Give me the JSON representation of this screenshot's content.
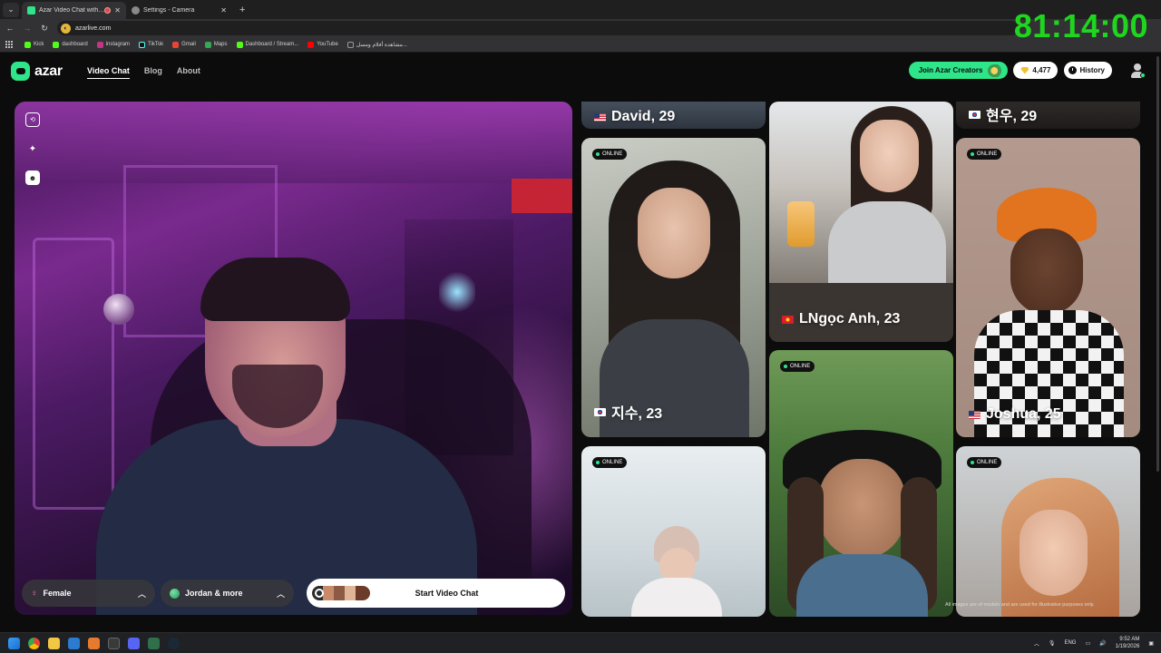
{
  "browser": {
    "tabs": [
      {
        "title": "Azar Video Chat with New",
        "active": true
      },
      {
        "title": "Settings - Camera",
        "active": false
      }
    ],
    "url": "azarlive.com",
    "bookmarks": [
      "Kick",
      "dashboard",
      "instagram",
      "TikTok",
      "Gmail",
      "Maps",
      "Dashboard / Stream...",
      "YouTube",
      "مشاهدة أفلام ومسل..."
    ]
  },
  "overlay": {
    "timer": "81:14:00"
  },
  "header": {
    "logo_text": "azar",
    "nav": [
      "Video Chat",
      "Blog",
      "About"
    ],
    "join_label": "Join Azar Creators",
    "coins": "4,477",
    "history_label": "History"
  },
  "camera": {
    "gender_filter": "Female",
    "region_filter": "Jordan & more",
    "start_label": "Start Video Chat"
  },
  "cards": [
    {
      "name": "David, 29",
      "flag": "us",
      "online": false
    },
    {
      "name": "LNgọc Anh, 23",
      "flag": "vn",
      "online": false
    },
    {
      "name": "현우, 29",
      "flag": "kr",
      "online": false
    },
    {
      "name": "지수, 23",
      "flag": "kr",
      "online": true
    },
    {
      "name": "Joshua, 25",
      "flag": "us",
      "online": true
    },
    {
      "name": "",
      "online": true
    },
    {
      "name": "",
      "online": true
    },
    {
      "name": "",
      "online": true
    }
  ],
  "online_label": "ONLINE",
  "disclaimer": "All images are of models and are used for illustrative purposes only.",
  "taskbar": {
    "lang": "ENG",
    "time": "9:52 AM",
    "date": "1/19/2026"
  },
  "colors": {
    "accent": "#2ee58a",
    "timer": "#1fd61f"
  }
}
